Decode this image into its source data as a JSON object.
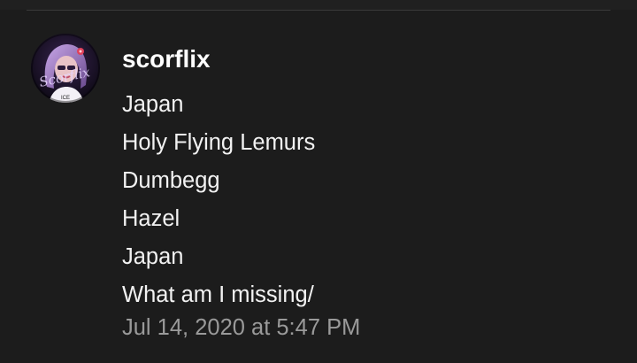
{
  "comment": {
    "author": "scorflix",
    "avatar_text": "Scorflix",
    "lines": [
      "Japan",
      "Holy Flying Lemurs",
      "Dumbegg",
      "Hazel",
      "Japan",
      "What am I missing/"
    ],
    "timestamp": "Jul 14, 2020 at 5:47 PM"
  },
  "colors": {
    "background": "#1c1c1c",
    "author_text": "#ffffff",
    "body_text": "#f2f2f2",
    "timestamp_text": "#9a9a9a",
    "divider": "#3a3a3a"
  }
}
